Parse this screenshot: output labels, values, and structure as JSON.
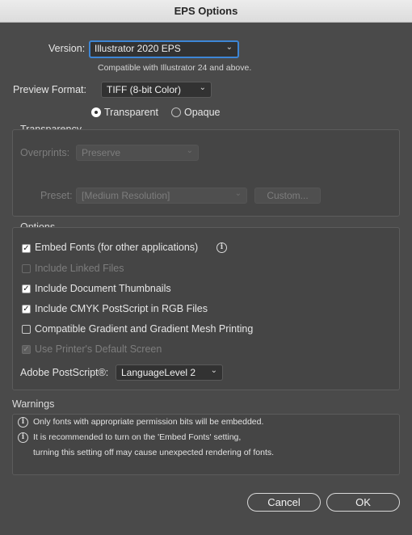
{
  "window": {
    "title": "EPS Options"
  },
  "version": {
    "label": "Version:",
    "value": "Illustrator 2020 EPS",
    "note": "Compatible with Illustrator 24 and above."
  },
  "preview": {
    "label": "Preview Format:",
    "value": "TIFF (8-bit Color)",
    "transparent_label": "Transparent",
    "opaque_label": "Opaque",
    "selected": "Transparent"
  },
  "transparency": {
    "title": "Transparency",
    "overprints_label": "Overprints:",
    "overprints_value": "Preserve",
    "preset_label": "Preset:",
    "preset_value": "[Medium Resolution]",
    "custom_label": "Custom..."
  },
  "options": {
    "title": "Options",
    "embed_fonts": {
      "label": "Embed Fonts (for other applications)",
      "checked": true
    },
    "include_linked": {
      "label": "Include Linked Files",
      "checked": false,
      "disabled": true
    },
    "doc_thumbnails": {
      "label": "Include Document Thumbnails",
      "checked": true
    },
    "cmyk_postscript": {
      "label": "Include CMYK PostScript in RGB Files",
      "checked": true
    },
    "gradient_mesh": {
      "label": "Compatible Gradient and Gradient Mesh Printing",
      "checked": false
    },
    "printer_screen": {
      "label": "Use Printer's Default Screen",
      "checked": true,
      "disabled": true
    },
    "postscript_label": "Adobe PostScript®:",
    "postscript_value": "LanguageLevel 2"
  },
  "warnings": {
    "title": "Warnings",
    "items": [
      "Only fonts with appropriate permission bits will be embedded.",
      "It is recommended to turn on the 'Embed Fonts' setting,",
      "turning this setting off may cause unexpected rendering of fonts."
    ]
  },
  "buttons": {
    "cancel": "Cancel",
    "ok": "OK"
  },
  "icons": {
    "chevron": "chevron-down-icon",
    "info": "info-icon",
    "check": "checkmark-icon"
  },
  "colors": {
    "focus": "#3d86d6",
    "background": "#4a4a4a"
  }
}
